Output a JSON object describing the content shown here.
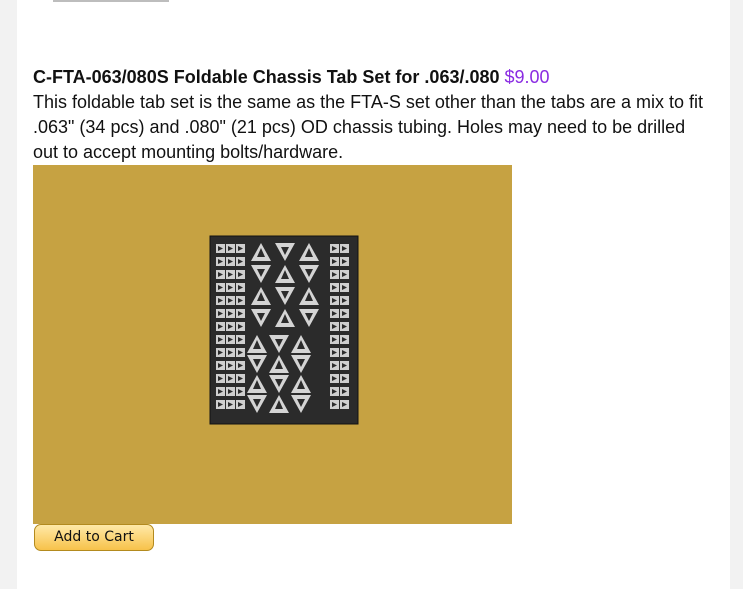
{
  "product": {
    "title": "C-FTA-063/080S Foldable Chassis Tab Set for .063/.080",
    "price": "$9.00",
    "description": "This foldable tab set is the same as the FTA-S set other than the tabs are a mix to fit .063\" (34 pcs) and .080\" (21 pcs) OD chassis tubing. Holes may need to be drilled out to accept mounting bolts/hardware.",
    "add_to_cart_label": "Add to Cart"
  },
  "colors": {
    "price": "#8a2be2",
    "button_fill": "#f7c24a",
    "photo_background": "#c7a23f",
    "tab_sheet": "#2b2b2b",
    "tab_part": "#cfcfcf"
  },
  "icons": [
    "product-photo-tab-sheet"
  ]
}
